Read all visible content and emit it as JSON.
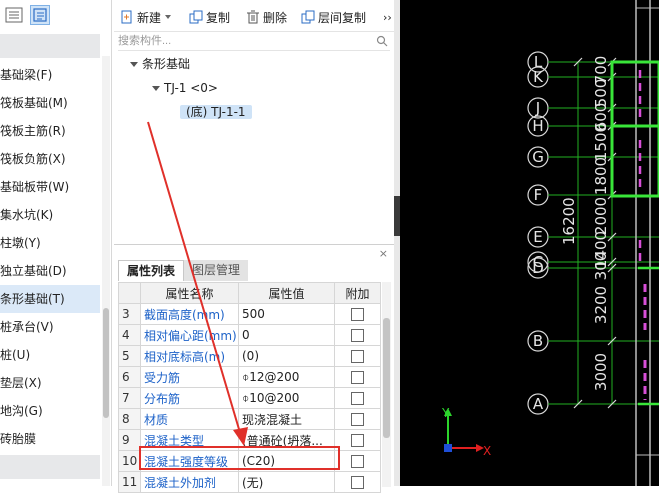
{
  "left_nav": {
    "items": [
      {
        "label": "基础梁(F)"
      },
      {
        "label": "筏板基础(M)"
      },
      {
        "label": "筏板主筋(R)"
      },
      {
        "label": "筏板负筋(X)"
      },
      {
        "label": "基础板带(W)"
      },
      {
        "label": "集水坑(K)"
      },
      {
        "label": "柱墩(Y)"
      },
      {
        "label": "独立基础(D)"
      },
      {
        "label": "条形基础(T)"
      },
      {
        "label": "桩承台(V)"
      },
      {
        "label": "桩(U)"
      },
      {
        "label": "垫层(X)"
      },
      {
        "label": "地沟(G)"
      },
      {
        "label": "砖胎膜"
      }
    ],
    "active_index": 8
  },
  "toolbar": {
    "new_label": "新建",
    "copy_label": "复制",
    "delete_label": "删除",
    "floor_copy_label": "层间复制",
    "more_label": "››"
  },
  "search": {
    "placeholder": "搜索构件..."
  },
  "tree": {
    "root_label": "条形基础",
    "child_label": "TJ-1 <0>",
    "leaf_label": "(底) TJ-1-1"
  },
  "properties": {
    "close_glyph": "×",
    "tabs": [
      {
        "label": "属性列表"
      },
      {
        "label": "图层管理"
      }
    ],
    "headers": {
      "name": "属性名称",
      "value": "属性值",
      "extra": "附加"
    },
    "rows": [
      {
        "num": "3",
        "name": "截面高度(mm)",
        "value": "500"
      },
      {
        "num": "4",
        "name": "相对偏心距(mm)",
        "value": "0"
      },
      {
        "num": "5",
        "name": "相对底标高(m)",
        "value": "(0)"
      },
      {
        "num": "6",
        "name": "受力筋",
        "value": "⌽12@200"
      },
      {
        "num": "7",
        "name": "分布筋",
        "value": "⌽10@200"
      },
      {
        "num": "8",
        "name": "材质",
        "value": "现浇混凝土"
      },
      {
        "num": "9",
        "name": "混凝土类型",
        "value": "(普通砼(坍落..."
      },
      {
        "num": "10",
        "name": "混凝土强度等级",
        "value": "(C20)"
      },
      {
        "num": "11",
        "name": "混凝土外加剂",
        "value": "(无)"
      }
    ]
  },
  "cad": {
    "axis_labels": [
      "L",
      "K",
      "J",
      "H",
      "G",
      "F",
      "E",
      "D",
      "C",
      "B",
      "A"
    ],
    "total_dimension": "16200",
    "segment_dimensions": [
      "700",
      "500",
      "600",
      "1500",
      "1800",
      "2000",
      "1400",
      "300",
      "3200",
      "3000"
    ],
    "ucs_x": "X",
    "ucs_y": "Y"
  },
  "colors": {
    "highlight_border": "#e0302a",
    "arrow": "#e0302a",
    "cad_background": "#000000",
    "beam_green": "#39e639",
    "beam_magenta": "#d84fd8",
    "property_name_blue": "#1d62c8"
  }
}
